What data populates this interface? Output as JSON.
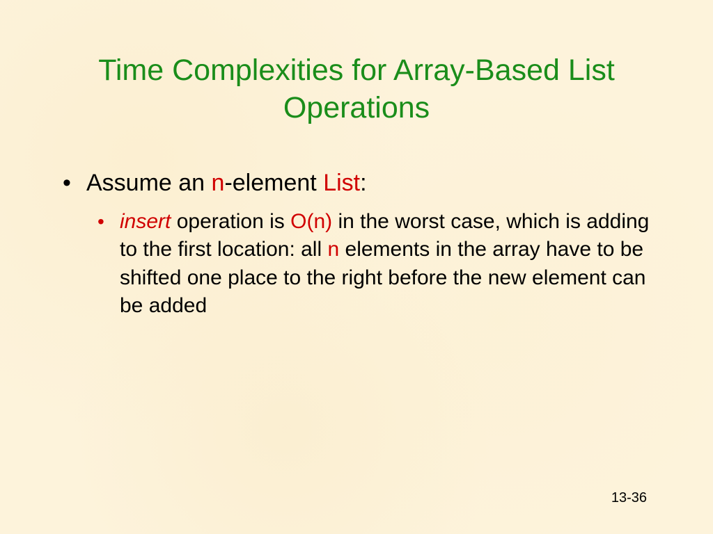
{
  "title": "Time Complexities for Array-Based List Operations",
  "bullet1": {
    "pre": "Assume an ",
    "n": "n",
    "mid": "-element ",
    "list": "List",
    "post": ":"
  },
  "bullet2": {
    "insert": "insert",
    "t1": " operation is ",
    "on": "O(n)",
    "t2": " in the worst case, which is adding to the first location: all ",
    "n": "n",
    "t3": " elements in the array have to be shifted one place to the right before the new element can be added"
  },
  "pageNumber": "13-36"
}
